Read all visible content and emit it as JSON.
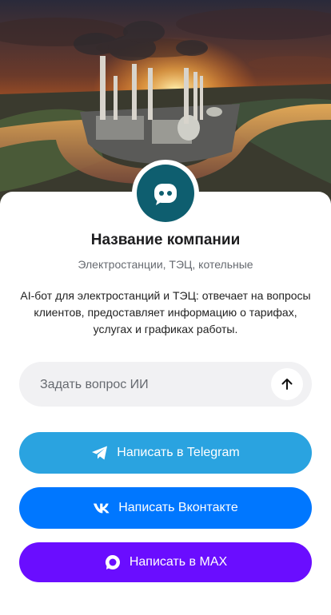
{
  "header": {
    "image_alt": "industrial power plant at sunset"
  },
  "company": {
    "name": "Название компании",
    "category": "Электростанции, ТЭЦ, котельные",
    "description": "AI-бот для электростанций и ТЭЦ: отвечает на вопросы клиентов, предоставляет информацию о тарифах, услугах и графиках работы."
  },
  "ask": {
    "placeholder": "Задать вопрос ИИ",
    "value": ""
  },
  "buttons": {
    "telegram": "Написать в Telegram",
    "vk": "Написать Вконтакте",
    "max": "Написать в MAX"
  },
  "colors": {
    "avatar": "#0e5e6f",
    "telegram": "#2aa3e0",
    "vk": "#0077ff",
    "max": "#6a0dff"
  }
}
